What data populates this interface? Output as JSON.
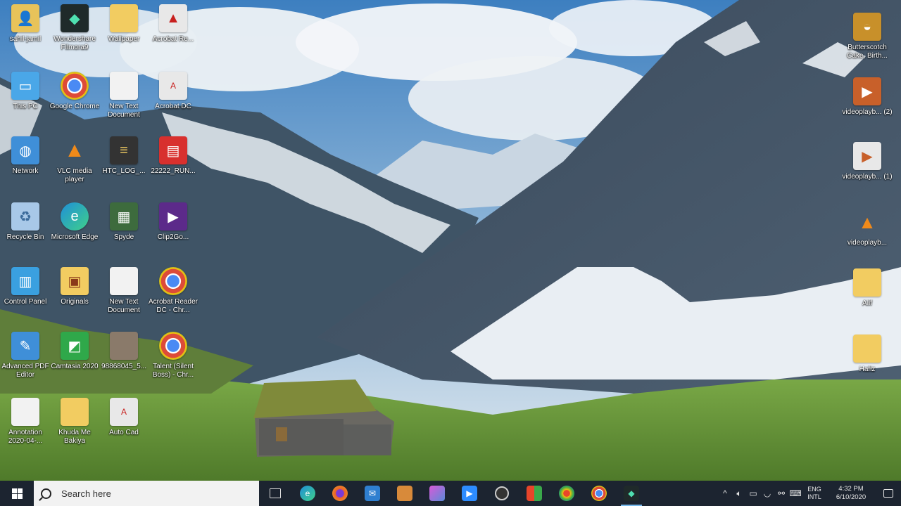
{
  "desktop": {
    "left_icons": [
      {
        "label": "sahil-jamil",
        "icon": "user-folder-icon",
        "color": "#e8c35a"
      },
      {
        "label": "Wondershare Filmora9",
        "icon": "filmora-icon",
        "color": "#1f2a2a"
      },
      {
        "label": "Wallpaper",
        "icon": "folder-icon",
        "color": "#f2cc61"
      },
      {
        "label": "Acrobat Re...",
        "icon": "acrobat-icon",
        "color": "#e8e8e8"
      },
      {
        "label": "This PC",
        "icon": "this-pc-icon",
        "color": "#4aa7e8"
      },
      {
        "label": "Google Chrome",
        "icon": "chrome-icon",
        "color": "#ffffff"
      },
      {
        "label": "New Text Document",
        "icon": "text-document-icon",
        "color": "#f2f2f2"
      },
      {
        "label": "Acrobat DC",
        "icon": "acrobat-dc-icon",
        "color": "#e8e8e8"
      },
      {
        "label": "Network",
        "icon": "network-icon",
        "color": "#3f8fd8"
      },
      {
        "label": "VLC media player",
        "icon": "vlc-icon",
        "color": "#f08a1a"
      },
      {
        "label": "HTC_LOG_...",
        "icon": "htc-log-icon",
        "color": "#333333"
      },
      {
        "label": "22222_RUN...",
        "icon": "red-app-icon",
        "color": "#d8302e"
      },
      {
        "label": "Recycle Bin",
        "icon": "recycle-bin-icon",
        "color": "#a8c8e8"
      },
      {
        "label": "Microsoft Edge",
        "icon": "edge-icon",
        "color": "#1f8fd8"
      },
      {
        "label": "Spyde",
        "icon": "spyde-icon",
        "color": "#3d6b3d"
      },
      {
        "label": "Clip2Go...",
        "icon": "purple-app-icon",
        "color": "#5c2a8a"
      },
      {
        "label": "Control Panel",
        "icon": "control-panel-icon",
        "color": "#3aa0e0"
      },
      {
        "label": "Originals",
        "icon": "originals-folder-icon",
        "color": "#f2cc61"
      },
      {
        "label": "New Text Document",
        "icon": "text-document-icon",
        "color": "#f2f2f2"
      },
      {
        "label": "Acrobat Reader DC - Chr...",
        "icon": "chrome-app-icon",
        "color": "#ffffff"
      },
      {
        "label": "Advanced PDF Editor",
        "icon": "pdf-editor-icon",
        "color": "#3f8fd8"
      },
      {
        "label": "Camtasia 2020",
        "icon": "camtasia-icon",
        "color": "#2fa84a"
      },
      {
        "label": "98868045_5...",
        "icon": "image-file-icon",
        "color": "#8a7a6a"
      },
      {
        "label": "Talent (Silent Boss) - Chr...",
        "icon": "chrome-app-icon",
        "color": "#ffffff"
      },
      {
        "label": "Annotation 2020-04-...",
        "icon": "annotation-file-icon",
        "color": "#f2f2f2"
      },
      {
        "label": "Khuda Me Bakiya",
        "icon": "folder-icon",
        "color": "#f2cc61"
      },
      {
        "label": "Auto Cad",
        "icon": "autocad-icon",
        "color": "#e8e8e8"
      }
    ],
    "right_icons": [
      {
        "label": "Butterscotch Cake, Birth...",
        "icon": "cake-image-icon",
        "color": "#c8902a"
      },
      {
        "label": "videoplayb... (2)",
        "icon": "video-file-icon",
        "color": "#c8602a"
      },
      {
        "label": "videoplayb... (1)",
        "icon": "video-file-icon",
        "color": "#e8e8e8"
      },
      {
        "label": "videoplayb...",
        "icon": "vlc-file-icon",
        "color": "#f08a1a"
      },
      {
        "label": "Alif",
        "icon": "alif-folder-icon",
        "color": "#f2cc61"
      },
      {
        "label": "Hafiz",
        "icon": "hafiz-folder-icon",
        "color": "#f2cc61"
      }
    ]
  },
  "taskbar": {
    "search_placeholder": "Search here",
    "apps": [
      {
        "name": "task-view",
        "icon": "task-view-icon",
        "color": "#1c2430",
        "glyph": "▭"
      },
      {
        "name": "edge",
        "icon": "edge-icon",
        "color": "#1f8fd8",
        "glyph": "e"
      },
      {
        "name": "firefox",
        "icon": "firefox-icon",
        "color": "#e8622a",
        "glyph": "●"
      },
      {
        "name": "mail",
        "icon": "mail-icon",
        "color": "#2f7fd0",
        "glyph": "✉"
      },
      {
        "name": "file-explorer",
        "icon": "folder-icon",
        "color": "#d88a3a",
        "glyph": "▦"
      },
      {
        "name": "photos",
        "icon": "photos-icon",
        "color": "#8a5ad8",
        "glyph": "▣"
      },
      {
        "name": "zoom",
        "icon": "zoom-icon",
        "color": "#2d8cff",
        "glyph": "▶"
      },
      {
        "name": "obs",
        "icon": "obs-icon",
        "color": "#555555",
        "glyph": "◉"
      },
      {
        "name": "store",
        "icon": "store-icon",
        "color": "#2f7fd0",
        "glyph": "⬒"
      },
      {
        "name": "paint",
        "icon": "paint-icon",
        "color": "#e8a02a",
        "glyph": "◆"
      },
      {
        "name": "chrome",
        "icon": "chrome-icon",
        "color": "#3aa84a",
        "glyph": "◍"
      },
      {
        "name": "filmora",
        "icon": "filmora-icon",
        "color": "#1f2a2a",
        "glyph": "◆"
      }
    ],
    "tray": {
      "lang_line1": "ENG",
      "lang_line2": "INTL",
      "time": "4:32 PM",
      "date": "6/10/2020"
    }
  }
}
